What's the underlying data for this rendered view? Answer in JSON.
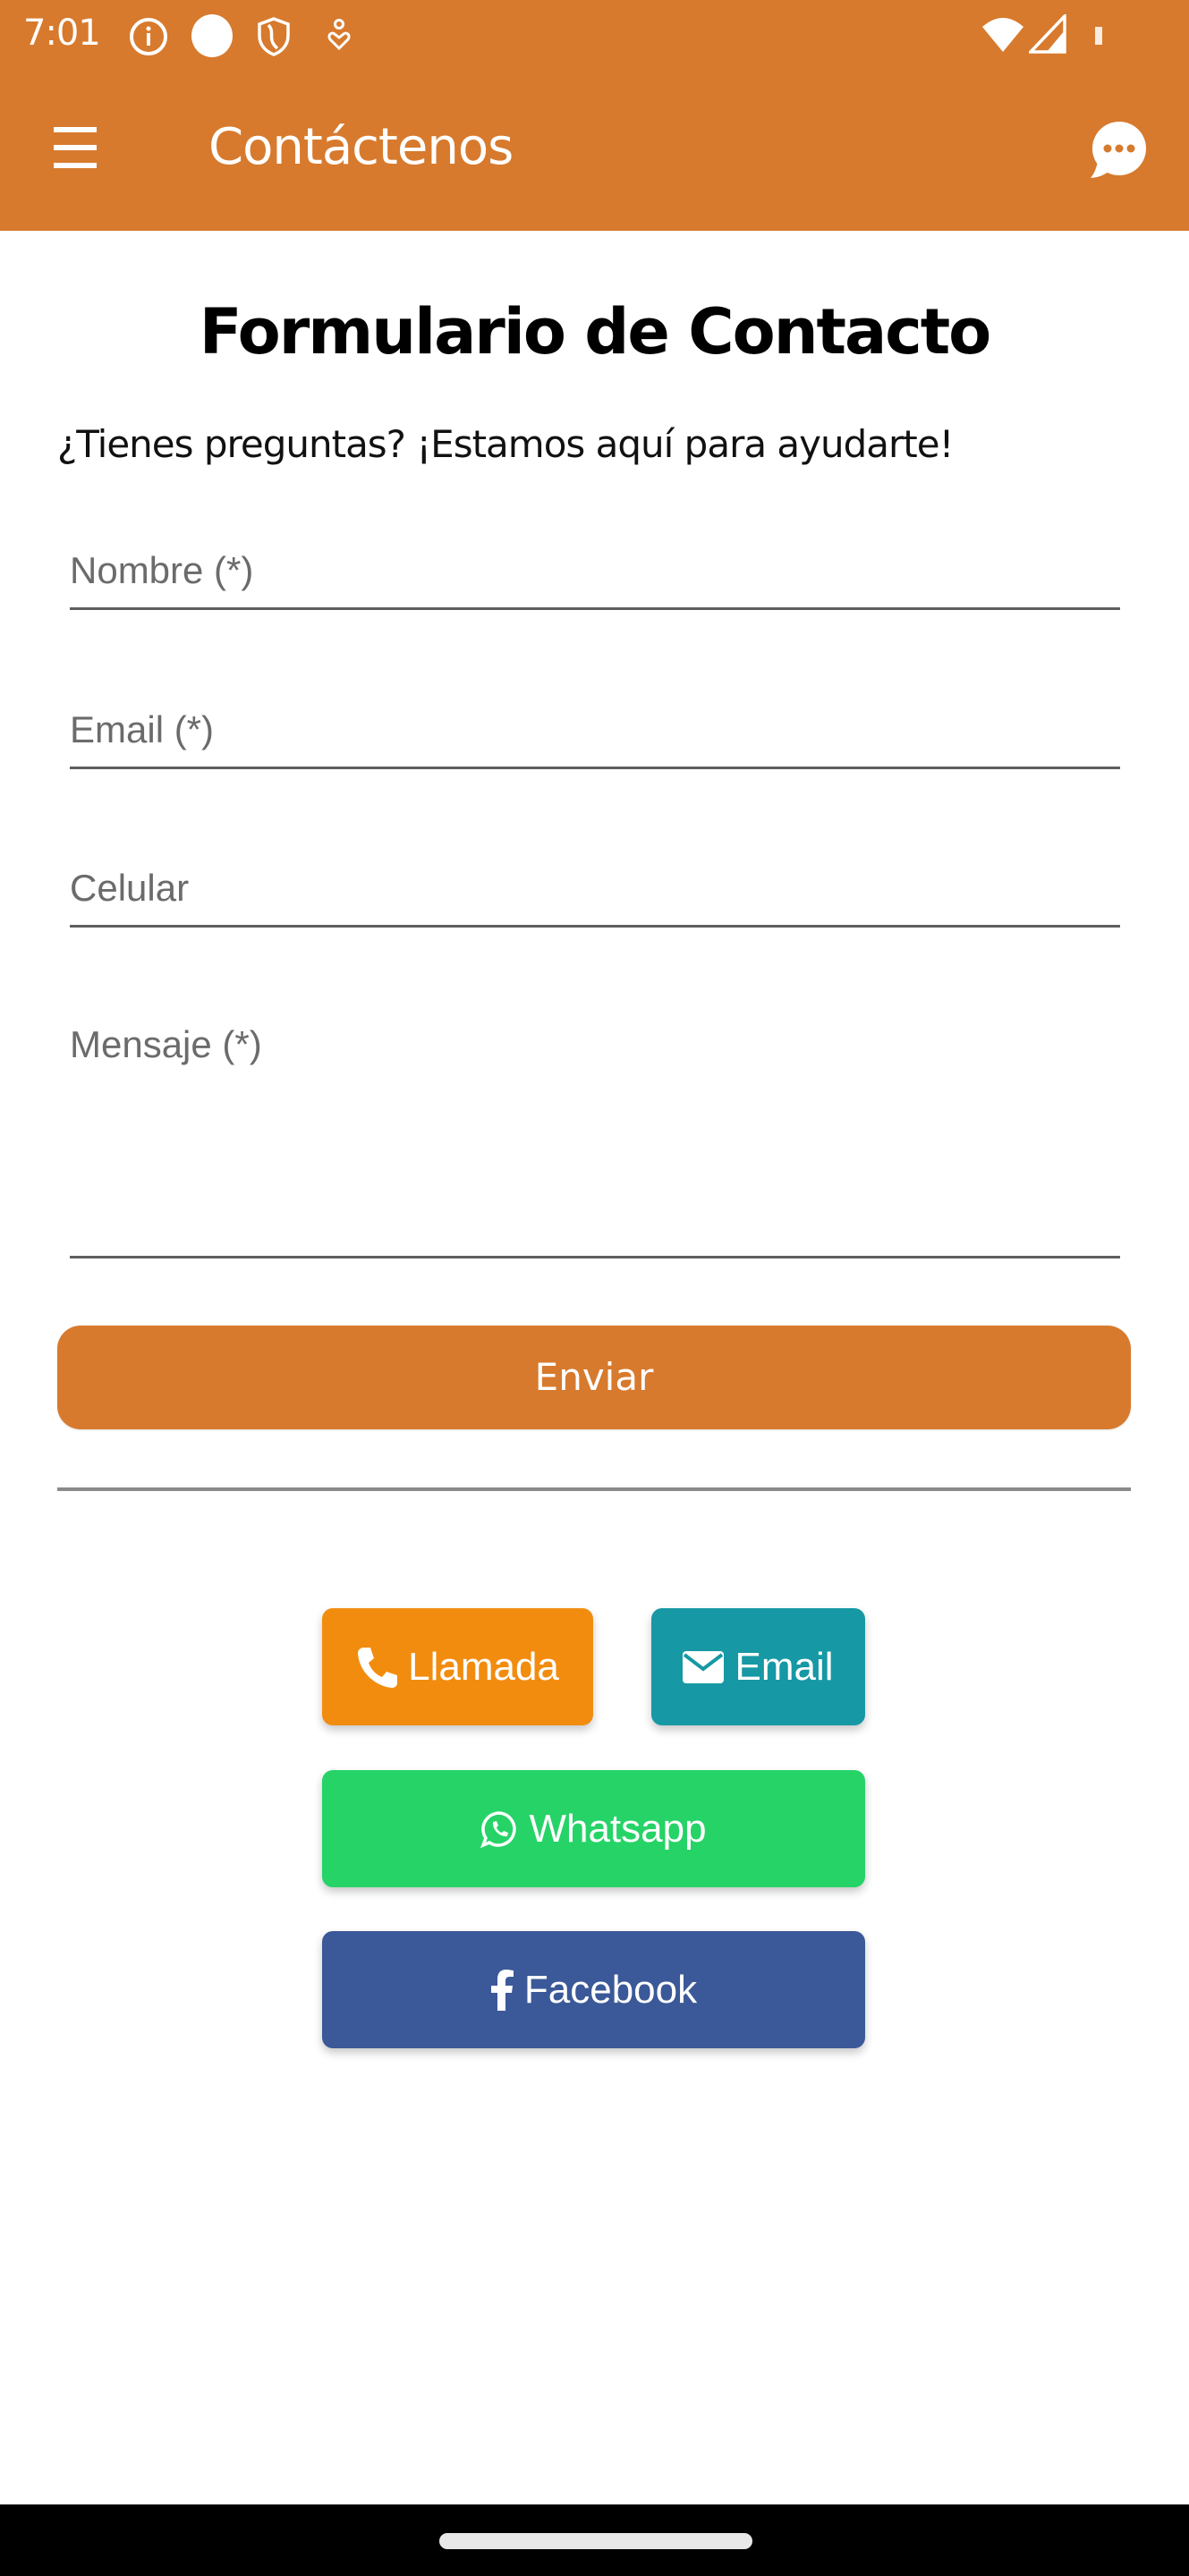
{
  "status_bar": {
    "time": "7:01",
    "icons": [
      "info-icon",
      "circle-icon",
      "shield-icon",
      "accessibility-icon",
      "wifi-icon",
      "signal-icon",
      "battery-icon"
    ]
  },
  "app_bar": {
    "title": "Contáctenos",
    "menu_icon": "hamburger-menu-icon",
    "chat_icon": "chat-bubble-icon"
  },
  "form": {
    "title": "Formulario de Contacto",
    "subtitle": "¿Tienes preguntas? ¡Estamos aquí para ayudarte!",
    "fields": [
      {
        "name": "nombre",
        "placeholder": "Nombre (*)",
        "value": ""
      },
      {
        "name": "email",
        "placeholder": "Email (*)",
        "value": ""
      },
      {
        "name": "celular",
        "placeholder": "Celular",
        "value": ""
      },
      {
        "name": "mensaje",
        "placeholder": "Mensaje (*)",
        "value": ""
      }
    ],
    "submit_label": "Enviar"
  },
  "contact_buttons": [
    {
      "label": "Llamada",
      "icon": "phone-icon",
      "color": "#F28C0F"
    },
    {
      "label": "Email",
      "icon": "envelope-icon",
      "color": "#1798A5"
    },
    {
      "label": "Whatsapp",
      "icon": "whatsapp-icon",
      "color": "#26D367"
    },
    {
      "label": "Facebook",
      "icon": "facebook-icon",
      "color": "#3B5998"
    }
  ],
  "colors": {
    "primary": "#D77A2D",
    "text": "#000000",
    "placeholder": "#6B6B6B"
  }
}
